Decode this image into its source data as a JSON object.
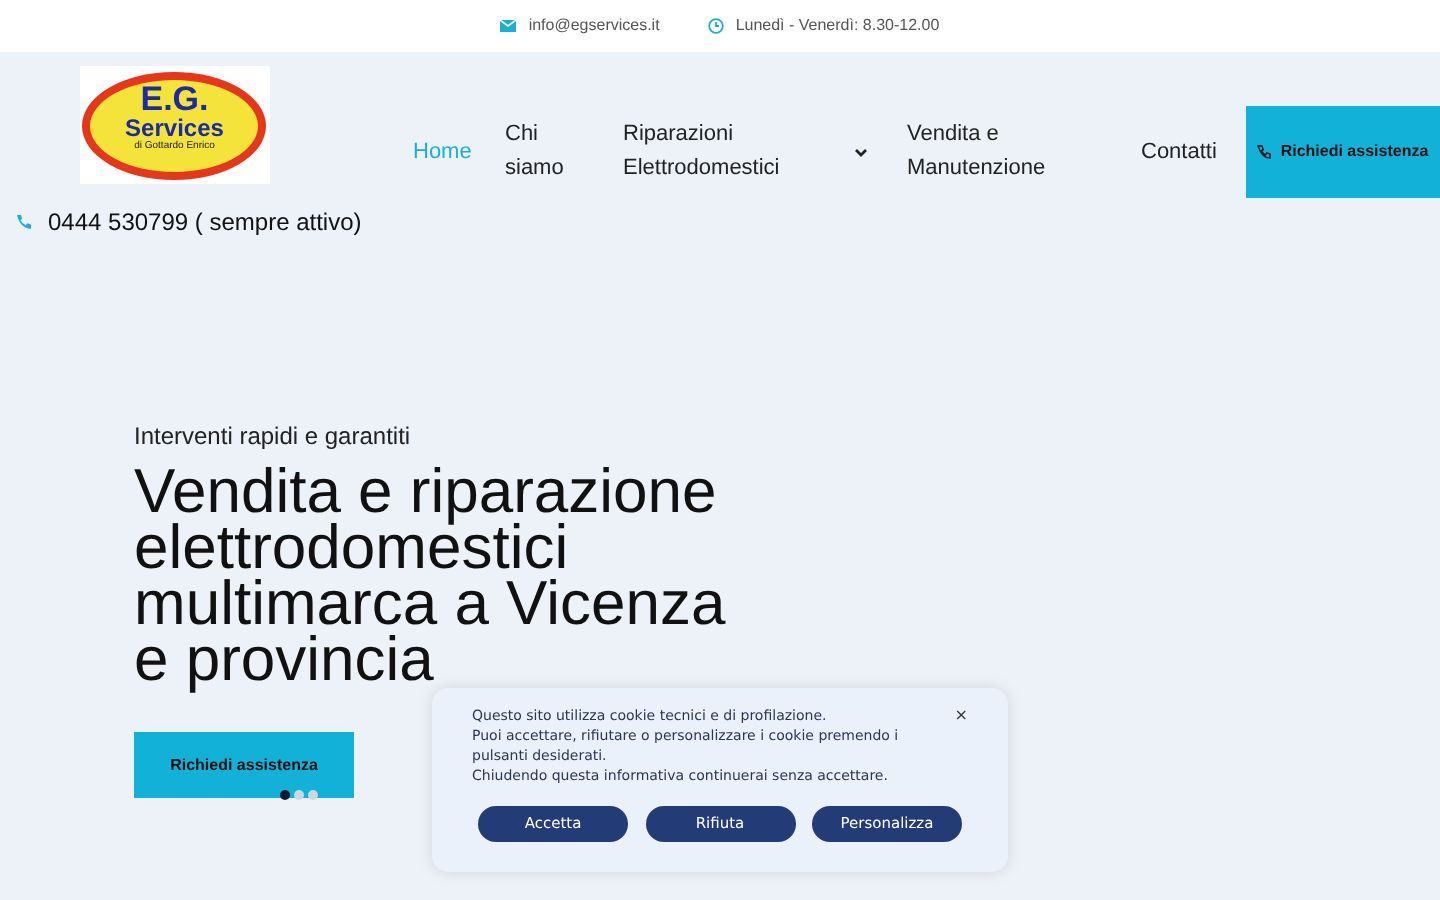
{
  "topbar": {
    "email": "info@egservices.it",
    "hours": "Lunedì - Venerdì: 8.30-12.00"
  },
  "logo": {
    "line1": "E.G.",
    "line2": "Services",
    "line3": "di Gottardo Enrico"
  },
  "nav": [
    {
      "label": "Home",
      "selected": true,
      "dropdown": false
    },
    {
      "label": "Chi siamo",
      "selected": false,
      "dropdown": false
    },
    {
      "label": "Riparazioni Elettrodomestici",
      "selected": false,
      "dropdown": true
    },
    {
      "label": "Vendita e Manutenzione",
      "selected": false,
      "dropdown": false
    },
    {
      "label": "Contatti",
      "selected": false,
      "dropdown": false
    }
  ],
  "cta": "Richiedi assistenza",
  "phone": "0444 530799 ( sempre attivo)",
  "hero": {
    "subtitle": "Interventi rapidi e garantiti",
    "title": "Vendita e riparazione elettrodomestici multimarca a Vicenza e provincia",
    "button": "Richiedi assistenza",
    "dots": [
      {
        "selected": true
      },
      {
        "selected": false
      },
      {
        "selected": false
      }
    ]
  },
  "cookie": {
    "lines": [
      "Questo sito utilizza cookie tecnici e di profilazione.",
      "Puoi accettare, rifiutare o personalizzare i cookie premendo i pulsanti desiderati.",
      "Chiudendo questa informativa continuerai senza accettare."
    ],
    "close": "×",
    "buttons": [
      "Accetta",
      "Rifiuta",
      "Personalizza"
    ]
  }
}
